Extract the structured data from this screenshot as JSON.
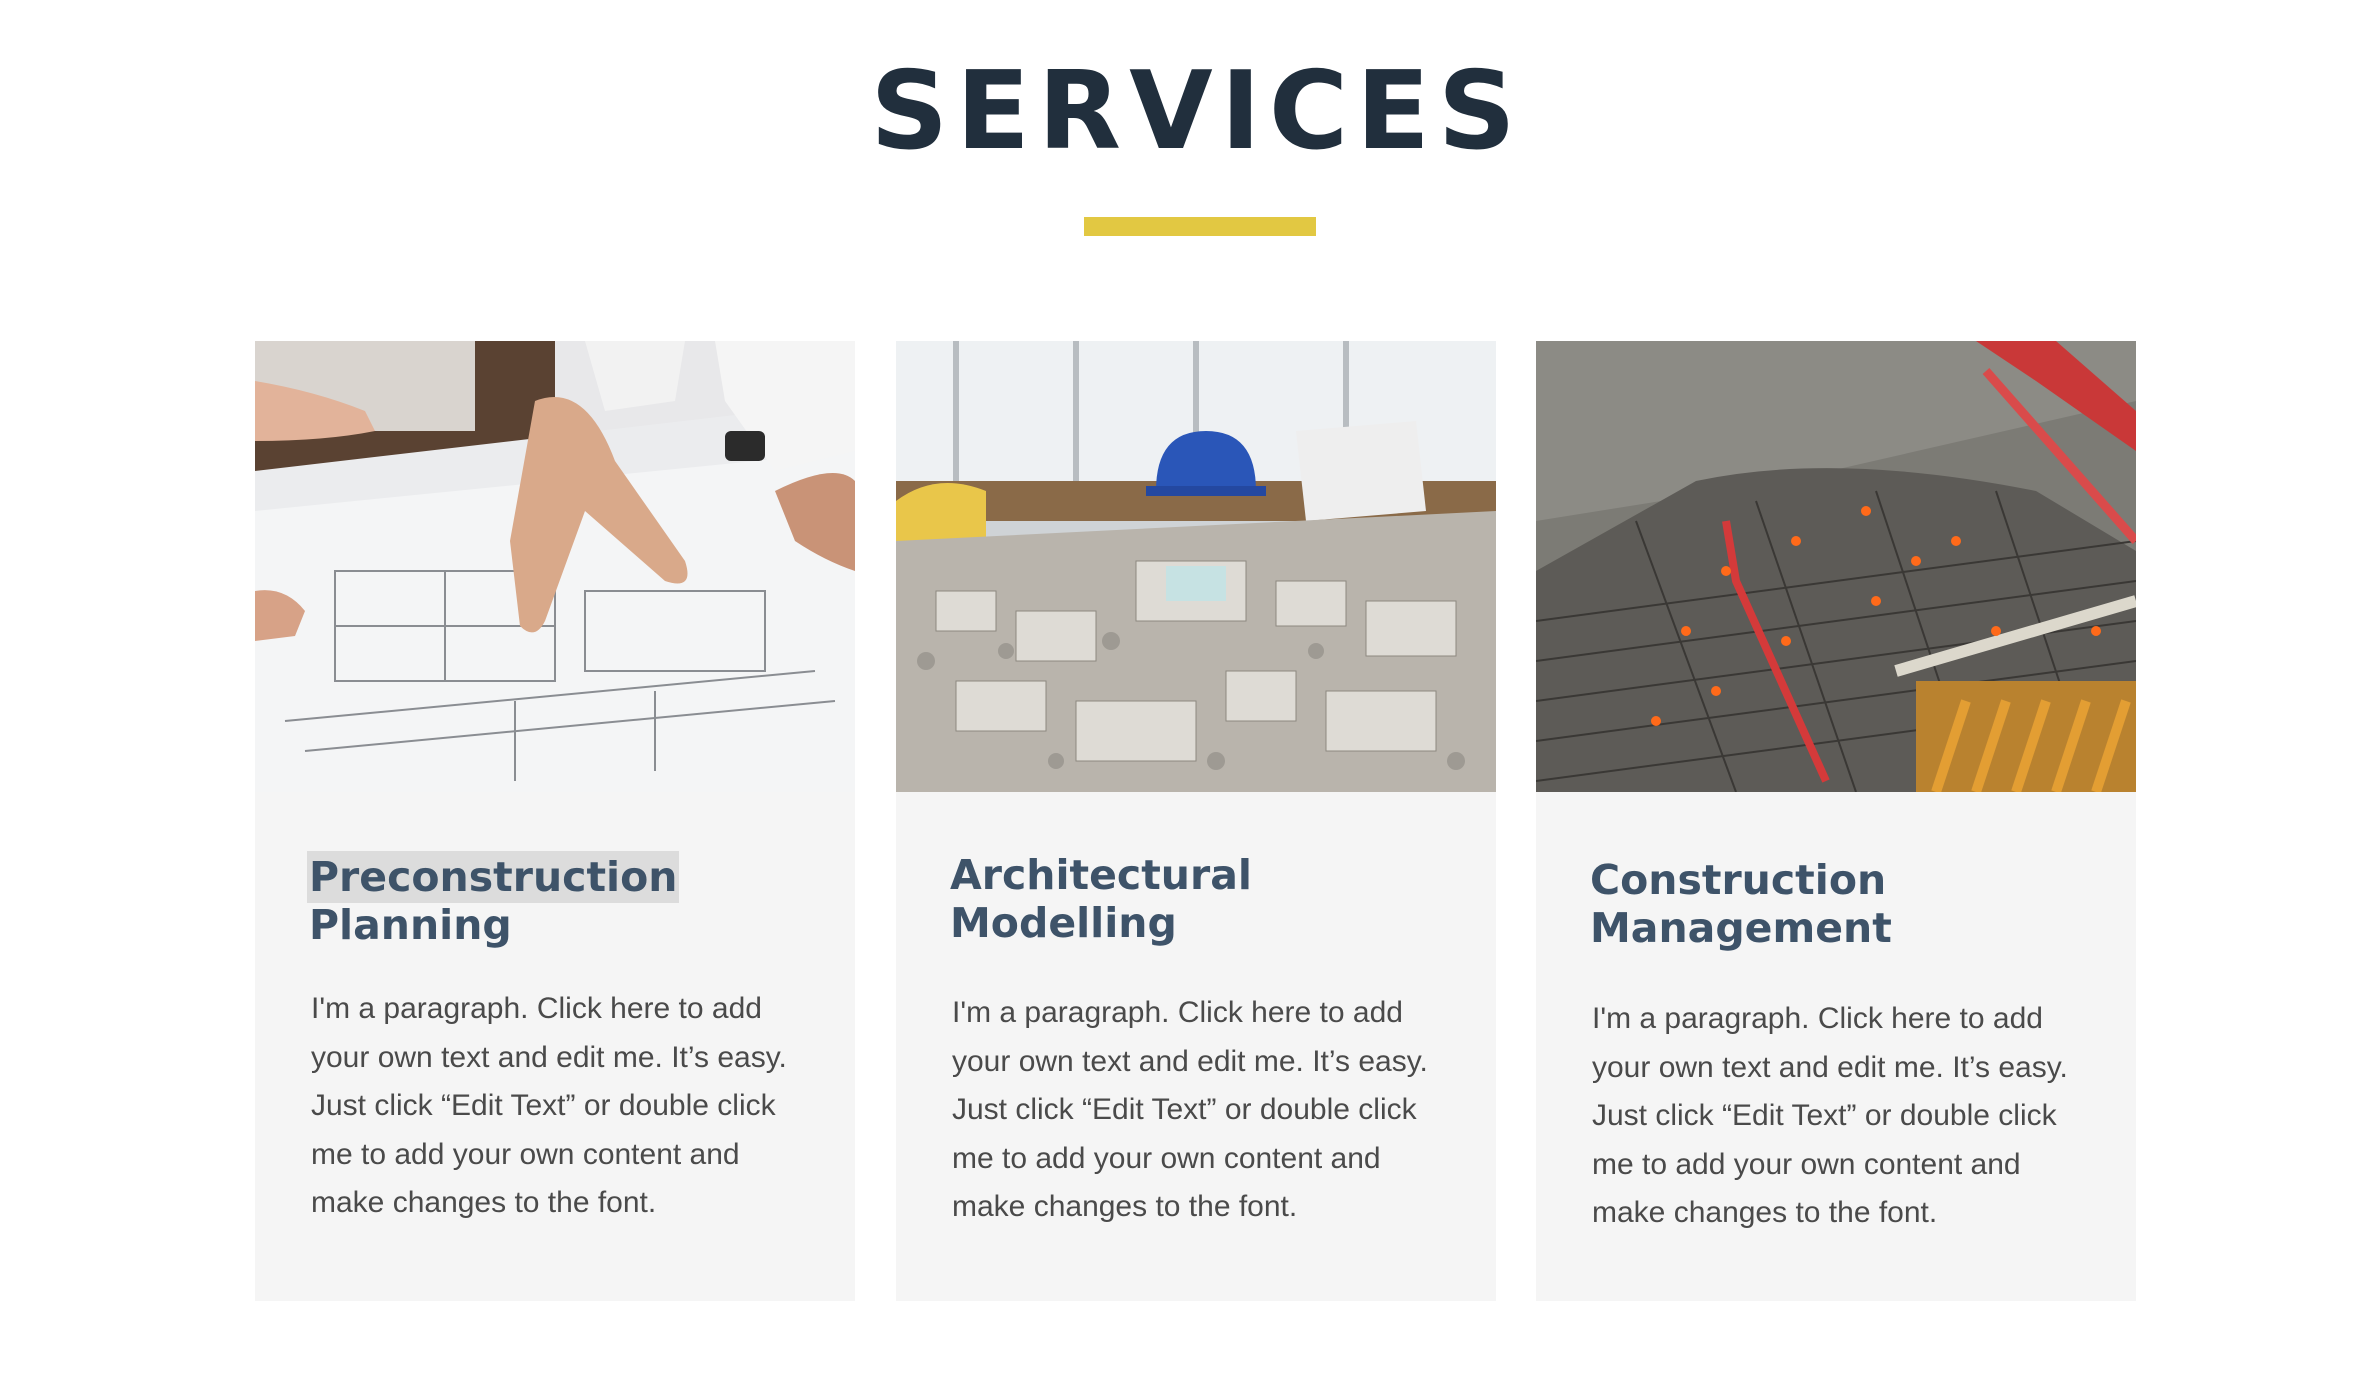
{
  "section": {
    "title": "SERVICES",
    "accent_color": "#e2c842",
    "heading_color": "#3e5369",
    "title_color": "#212f3d"
  },
  "cards": [
    {
      "heading_line1": "Preconstruction",
      "heading_line2": "Planning",
      "paragraph": "I'm a paragraph. Click here to add your own text and edit me. It’s easy. Just click “Edit Text” or double click me to add your own content and make changes to the font.",
      "image_icon": "blueprint-photo"
    },
    {
      "heading_line1": "Architectural",
      "heading_line2": "Modelling",
      "paragraph": "I'm a paragraph. Click here to add your own text and edit me. It’s easy. Just click “Edit Text” or double click me to add your own content and make changes to the font.",
      "image_icon": "architectural-model-photo"
    },
    {
      "heading_line1": "Construction",
      "heading_line2": "Management",
      "paragraph": "I'm a paragraph. Click here to add your own text and edit me. It’s easy. Just click “Edit Text” or double click me to add your own content and make changes to the font.",
      "image_icon": "construction-site-photo"
    }
  ]
}
